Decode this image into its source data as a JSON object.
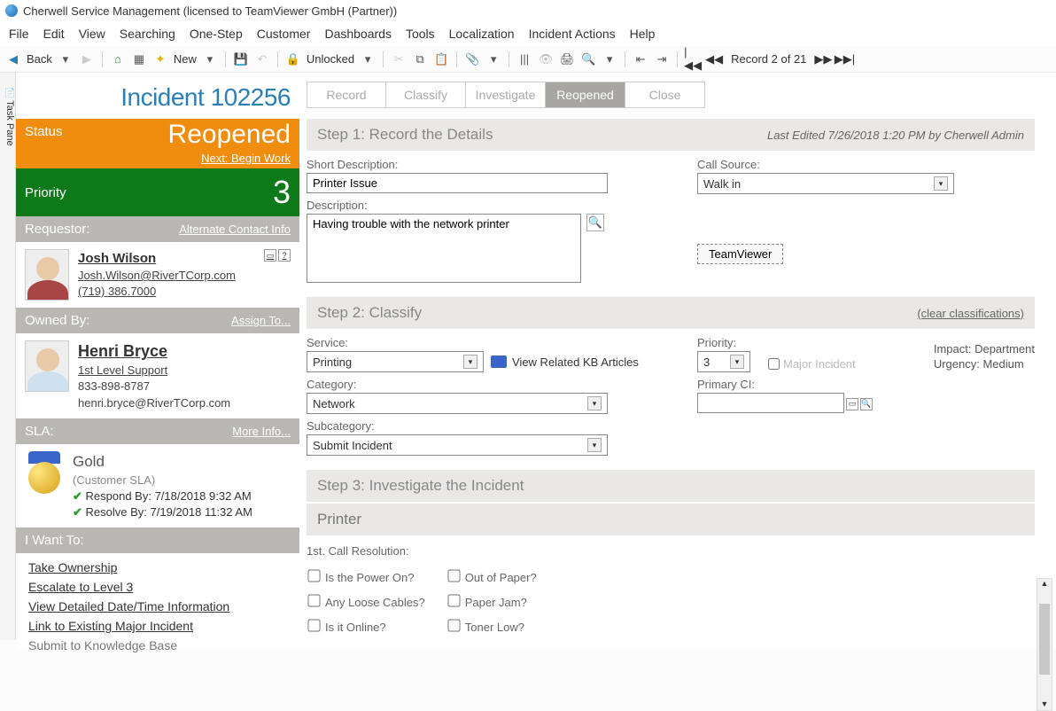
{
  "titlebar": {
    "text": "Cherwell Service Management (licensed to TeamViewer GmbH (Partner))"
  },
  "menu": [
    "File",
    "Edit",
    "View",
    "Searching",
    "One-Step",
    "Customer",
    "Dashboards",
    "Tools",
    "Localization",
    "Incident Actions",
    "Help"
  ],
  "toolbar": {
    "back": "Back",
    "new": "New",
    "unlocked": "Unlocked",
    "record_pos": "Record 2 of 21"
  },
  "taskpane_label": "Task Pane",
  "incident": {
    "title": "Incident 102256"
  },
  "status": {
    "label": "Status",
    "value": "Reopened",
    "next": "Next: Begin Work"
  },
  "priority": {
    "label": "Priority",
    "value": "3"
  },
  "requestor": {
    "header": "Requestor:",
    "alt_link": "Alternate Contact Info",
    "name": "Josh Wilson",
    "email": "Josh.Wilson@RiverTCorp.com",
    "phone": "(719) 386.7000"
  },
  "owned": {
    "header": "Owned By:",
    "assign_link": "Assign To...",
    "name": "Henri Bryce",
    "role": "1st Level Support",
    "phone": "833-898-8787",
    "email": "henri.bryce@RiverTCorp.com"
  },
  "sla": {
    "header": "SLA:",
    "more_link": "More Info...",
    "tier": "Gold",
    "type": "(Customer SLA)",
    "respond": "Respond By: 7/18/2018 9:32 AM",
    "resolve": "Resolve By: 7/19/2018 11:32 AM"
  },
  "iwant": {
    "header": "I Want To:",
    "links": [
      "Take Ownership",
      "Escalate to Level 3",
      "View Detailed Date/Time Information",
      "Link to Existing Major Incident",
      "Submit to Knowledge Base"
    ]
  },
  "tabs": [
    "Record",
    "Classify",
    "Investigate",
    "Reopened",
    "Close"
  ],
  "step1": {
    "title": "Step 1:  Record the Details",
    "last_edited": "Last Edited 7/26/2018 1:20 PM by  Cherwell Admin",
    "short_desc_label": "Short Description:",
    "short_desc": "Printer Issue",
    "call_source_label": "Call Source:",
    "call_source": "Walk in",
    "desc_label": "Description:",
    "desc": "Having trouble with the network printer",
    "tv_btn": "TeamViewer"
  },
  "step2": {
    "title": "Step 2:  Classify",
    "clear": "(clear classifications)",
    "service_label": "Service:",
    "service": "Printing",
    "kb_link": "View Related KB Articles",
    "category_label": "Category:",
    "category": "Network",
    "subcategory_label": "Subcategory:",
    "subcategory": "Submit Incident",
    "priority_label": "Priority:",
    "priority": "3",
    "major_incident": "Major Incident",
    "primary_ci_label": "Primary CI:",
    "primary_ci": "",
    "impact": "Impact: Department",
    "urgency": "Urgency: Medium"
  },
  "step3": {
    "title": "Step 3:  Investigate the Incident",
    "subheader": "Printer",
    "cl_title": "1st. Call Resolution:",
    "col1": [
      "Is the Power On?",
      "Any Loose Cables?",
      "Is it Online?"
    ],
    "col2": [
      "Out of Paper?",
      "Paper Jam?",
      "Toner Low?"
    ]
  }
}
